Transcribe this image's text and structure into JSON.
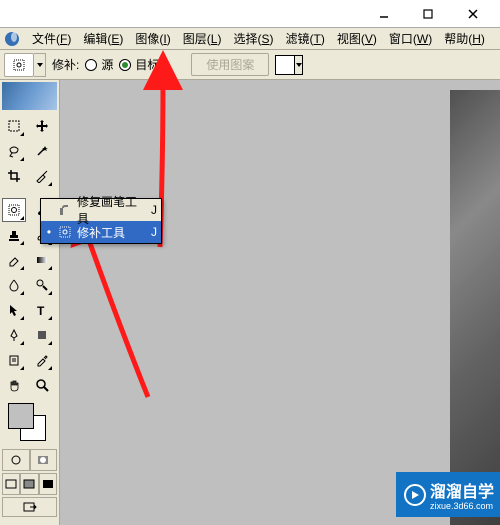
{
  "titlebar": {
    "minimize": "–",
    "maximize": "□",
    "close": "×"
  },
  "menubar": {
    "items": [
      {
        "label": "文件",
        "mn": "F"
      },
      {
        "label": "编辑",
        "mn": "E"
      },
      {
        "label": "图像",
        "mn": "I"
      },
      {
        "label": "图层",
        "mn": "L"
      },
      {
        "label": "选择",
        "mn": "S"
      },
      {
        "label": "滤镜",
        "mn": "T"
      },
      {
        "label": "视图",
        "mn": "V"
      },
      {
        "label": "窗口",
        "mn": "W"
      },
      {
        "label": "帮助",
        "mn": "H"
      }
    ]
  },
  "optbar": {
    "label": "修补:",
    "source": "源",
    "target": "目标",
    "pattern_btn": "使用图案"
  },
  "flyout": {
    "items": [
      {
        "label": "修复画笔工具",
        "shortcut": "J",
        "selected": false
      },
      {
        "label": "修补工具",
        "shortcut": "J",
        "selected": true
      }
    ]
  },
  "watermark": {
    "brand": "溜溜自学",
    "sub": "zixue.3d66.com"
  }
}
